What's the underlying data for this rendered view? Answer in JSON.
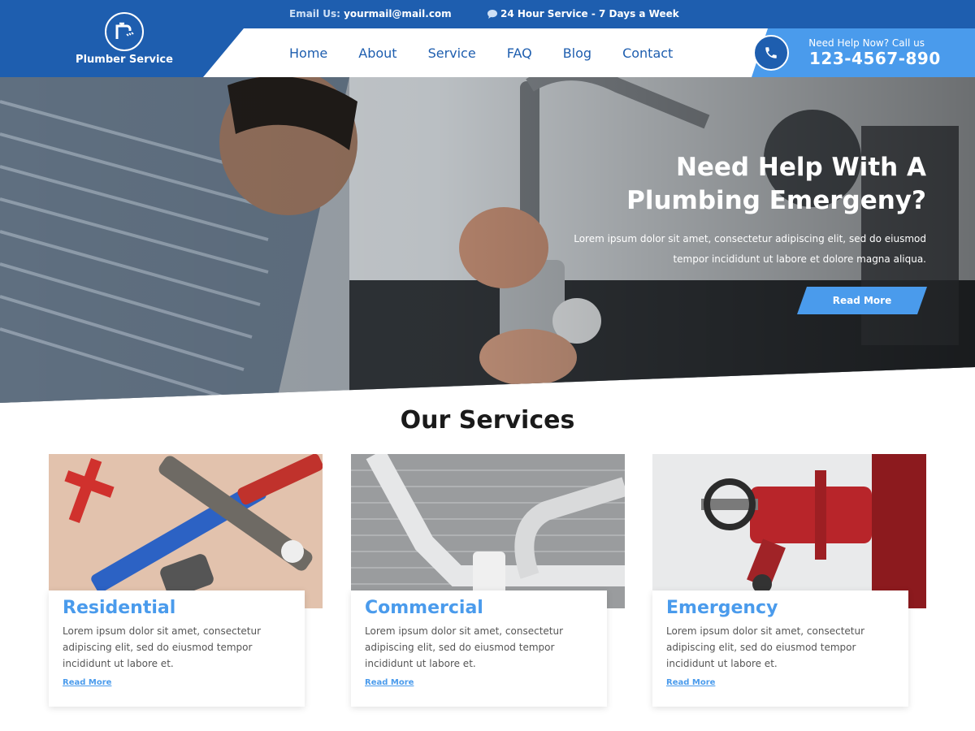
{
  "brand": {
    "name": "Plumber Service",
    "logo_icon": "faucet-icon"
  },
  "topbar": {
    "email_label": "Email Us:",
    "email": "yourmail@mail.com",
    "hours_icon": "chat-bubble-icon",
    "hours": "24 Hour Service - 7 Days a Week"
  },
  "nav": [
    "Home",
    "About",
    "Service",
    "FAQ",
    "Blog",
    "Contact"
  ],
  "call": {
    "icon": "phone-icon",
    "label": "Need Help Now? Call us",
    "number": "123-4567-890"
  },
  "hero": {
    "title_line1": "Need Help With A",
    "title_line2": "Plumbing Emergeny?",
    "text_line1": "Lorem ipsum dolor sit amet, consectetur adipiscing elit, sed do eiusmod",
    "text_line2": "tempor incididunt ut labore et dolore magna aliqua.",
    "button": "Read More"
  },
  "services": {
    "title": "Our Services",
    "cards": [
      {
        "title": "Residential",
        "text": "Lorem ipsum dolor sit amet, consectetur adipiscing elit, sed do eiusmod tempor incididunt ut labore et.",
        "link": "Read More"
      },
      {
        "title": "Commercial",
        "text": "Lorem ipsum dolor sit amet, consectetur adipiscing elit, sed do eiusmod tempor incididunt ut labore et.",
        "link": "Read More"
      },
      {
        "title": "Emergency",
        "text": "Lorem ipsum dolor sit amet, consectetur adipiscing elit, sed do eiusmod tempor incididunt ut labore et.",
        "link": "Read More"
      }
    ]
  },
  "colors": {
    "primary": "#1e5eaf",
    "accent": "#4a9bec"
  }
}
